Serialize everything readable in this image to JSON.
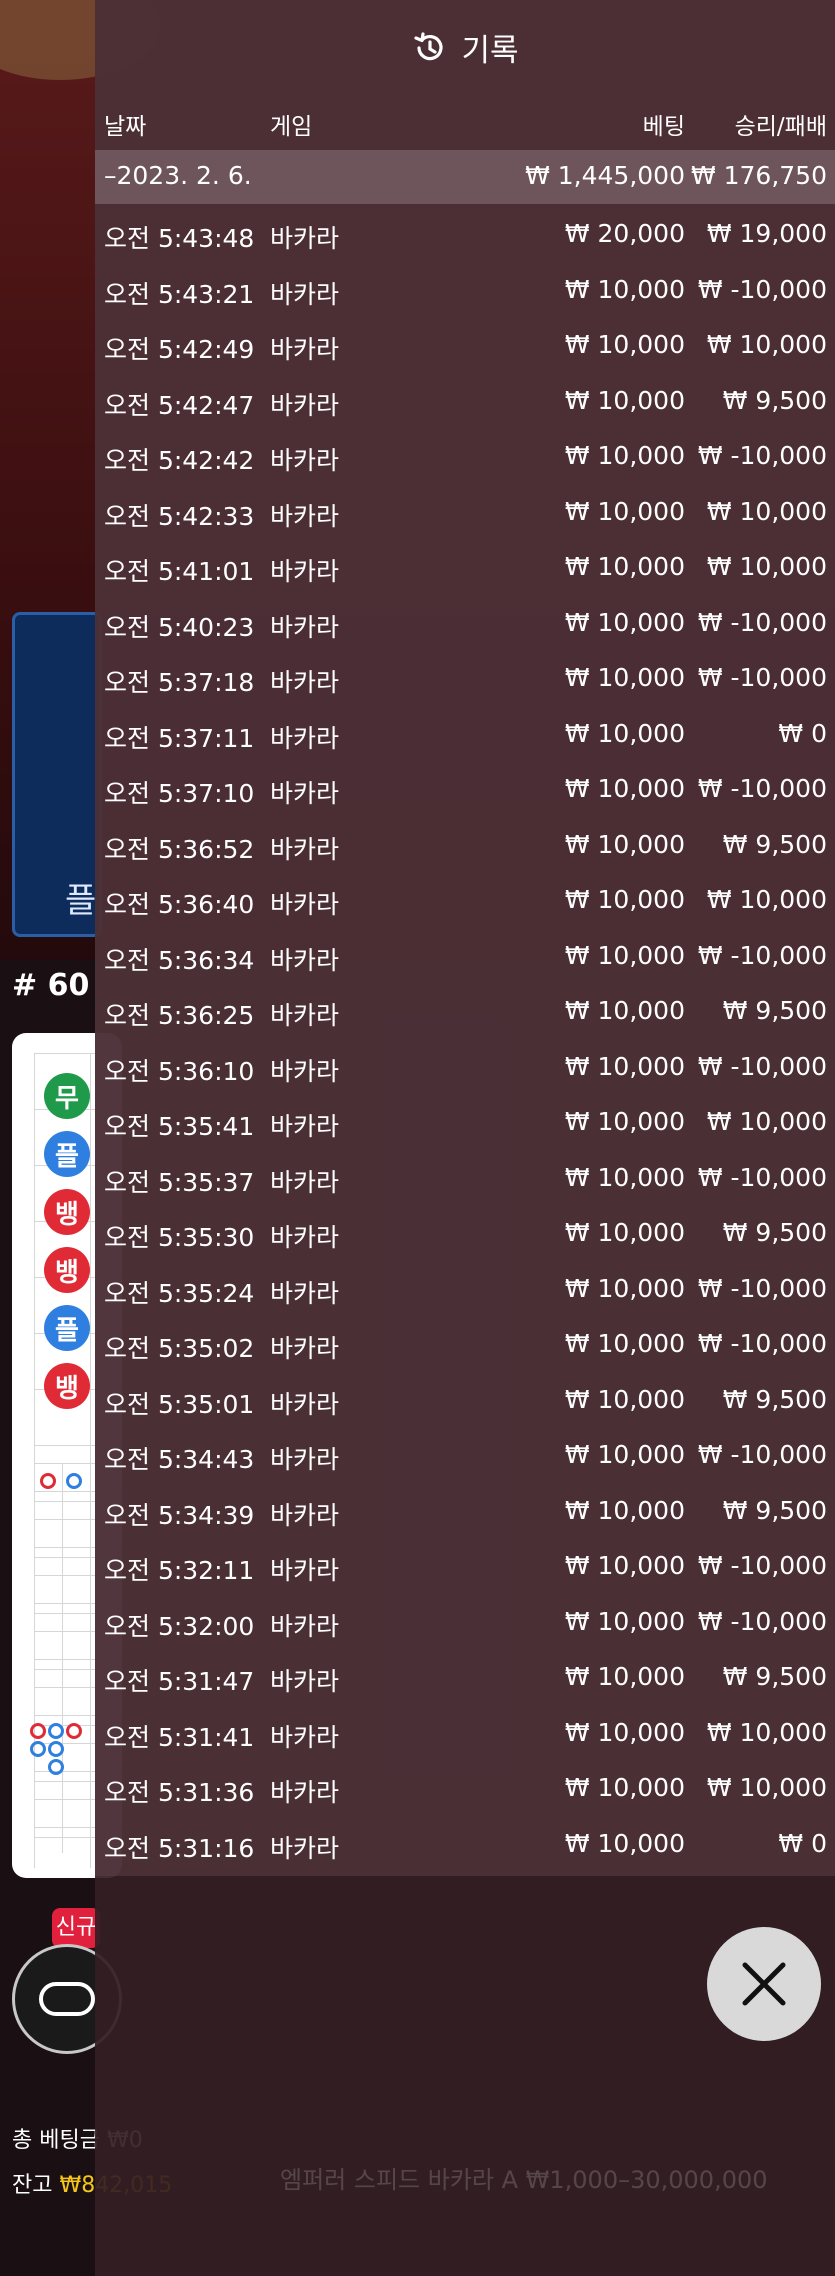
{
  "background": {
    "side_button_label": "플",
    "round_label": "# 60",
    "bead_road": [
      "무",
      "플",
      "뱅",
      "뱅",
      "플",
      "뱅"
    ],
    "new_badge": "신규",
    "total_bet_label": "총 베팅금",
    "total_bet_value": "₩0",
    "balance_label": "잔고",
    "balance_value": "₩842,015",
    "table_info": "엠퍼러 스피드 바카라 A  ₩1,000–30,000,000"
  },
  "history": {
    "title": "기록",
    "columns": {
      "date": "날짜",
      "game": "게임",
      "bet": "베팅",
      "result": "승리/패배"
    },
    "date_group": {
      "label": "–2023. 2. 6.",
      "bet_total": "₩ 1,445,000",
      "result_total": "₩ 176,750"
    },
    "rows": [
      {
        "time": "오전 5:43:48",
        "game": "바카라",
        "bet": "₩ 20,000",
        "result": "₩ 19,000"
      },
      {
        "time": "오전 5:43:21",
        "game": "바카라",
        "bet": "₩ 10,000",
        "result": "₩ -10,000"
      },
      {
        "time": "오전 5:42:49",
        "game": "바카라",
        "bet": "₩ 10,000",
        "result": "₩ 10,000"
      },
      {
        "time": "오전 5:42:47",
        "game": "바카라",
        "bet": "₩ 10,000",
        "result": "₩ 9,500"
      },
      {
        "time": "오전 5:42:42",
        "game": "바카라",
        "bet": "₩ 10,000",
        "result": "₩ -10,000"
      },
      {
        "time": "오전 5:42:33",
        "game": "바카라",
        "bet": "₩ 10,000",
        "result": "₩ 10,000"
      },
      {
        "time": "오전 5:41:01",
        "game": "바카라",
        "bet": "₩ 10,000",
        "result": "₩ 10,000"
      },
      {
        "time": "오전 5:40:23",
        "game": "바카라",
        "bet": "₩ 10,000",
        "result": "₩ -10,000"
      },
      {
        "time": "오전 5:37:18",
        "game": "바카라",
        "bet": "₩ 10,000",
        "result": "₩ -10,000"
      },
      {
        "time": "오전 5:37:11",
        "game": "바카라",
        "bet": "₩ 10,000",
        "result": "₩ 0"
      },
      {
        "time": "오전 5:37:10",
        "game": "바카라",
        "bet": "₩ 10,000",
        "result": "₩ -10,000"
      },
      {
        "time": "오전 5:36:52",
        "game": "바카라",
        "bet": "₩ 10,000",
        "result": "₩ 9,500"
      },
      {
        "time": "오전 5:36:40",
        "game": "바카라",
        "bet": "₩ 10,000",
        "result": "₩ 10,000"
      },
      {
        "time": "오전 5:36:34",
        "game": "바카라",
        "bet": "₩ 10,000",
        "result": "₩ -10,000"
      },
      {
        "time": "오전 5:36:25",
        "game": "바카라",
        "bet": "₩ 10,000",
        "result": "₩ 9,500"
      },
      {
        "time": "오전 5:36:10",
        "game": "바카라",
        "bet": "₩ 10,000",
        "result": "₩ -10,000"
      },
      {
        "time": "오전 5:35:41",
        "game": "바카라",
        "bet": "₩ 10,000",
        "result": "₩ 10,000"
      },
      {
        "time": "오전 5:35:37",
        "game": "바카라",
        "bet": "₩ 10,000",
        "result": "₩ -10,000"
      },
      {
        "time": "오전 5:35:30",
        "game": "바카라",
        "bet": "₩ 10,000",
        "result": "₩ 9,500"
      },
      {
        "time": "오전 5:35:24",
        "game": "바카라",
        "bet": "₩ 10,000",
        "result": "₩ -10,000"
      },
      {
        "time": "오전 5:35:02",
        "game": "바카라",
        "bet": "₩ 10,000",
        "result": "₩ -10,000"
      },
      {
        "time": "오전 5:35:01",
        "game": "바카라",
        "bet": "₩ 10,000",
        "result": "₩ 9,500"
      },
      {
        "time": "오전 5:34:43",
        "game": "바카라",
        "bet": "₩ 10,000",
        "result": "₩ -10,000"
      },
      {
        "time": "오전 5:34:39",
        "game": "바카라",
        "bet": "₩ 10,000",
        "result": "₩ 9,500"
      },
      {
        "time": "오전 5:32:11",
        "game": "바카라",
        "bet": "₩ 10,000",
        "result": "₩ -10,000"
      },
      {
        "time": "오전 5:32:00",
        "game": "바카라",
        "bet": "₩ 10,000",
        "result": "₩ -10,000"
      },
      {
        "time": "오전 5:31:47",
        "game": "바카라",
        "bet": "₩ 10,000",
        "result": "₩ 9,500"
      },
      {
        "time": "오전 5:31:41",
        "game": "바카라",
        "bet": "₩ 10,000",
        "result": "₩ 10,000"
      },
      {
        "time": "오전 5:31:36",
        "game": "바카라",
        "bet": "₩ 10,000",
        "result": "₩ 10,000"
      },
      {
        "time": "오전 5:31:16",
        "game": "바카라",
        "bet": "₩ 10,000",
        "result": "₩ 0"
      }
    ]
  },
  "colors": {
    "tie": "#1f9a4a",
    "player": "#2f7fe0",
    "banker": "#e02b36",
    "balance_gold": "#f5c518"
  },
  "icons": {
    "header": "history-icon",
    "close": "close-icon"
  }
}
